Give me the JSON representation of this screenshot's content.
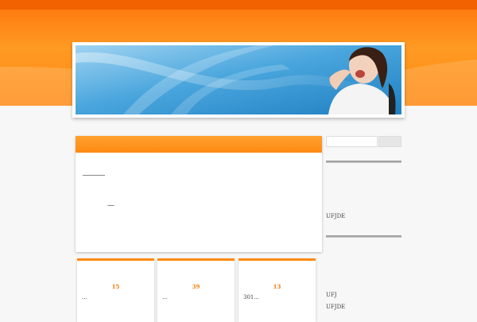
{
  "header": {
    "banner": {
      "description_icon": "banner-photo-icon"
    }
  },
  "main": {
    "title": "",
    "mark": "—"
  },
  "sidebar": {
    "search": {
      "placeholder": "",
      "button_label": ""
    },
    "links": [
      "UFJDE",
      "UFJ",
      "UFJDE"
    ]
  },
  "cards": [
    {
      "number": "15",
      "text": "..."
    },
    {
      "number": "39",
      "text": "..."
    },
    {
      "number": "13",
      "text": "301..."
    }
  ],
  "colors": {
    "accent": "#ff8a12",
    "accent_dark": "#f26200",
    "banner_blue": "#3a9fd8"
  }
}
